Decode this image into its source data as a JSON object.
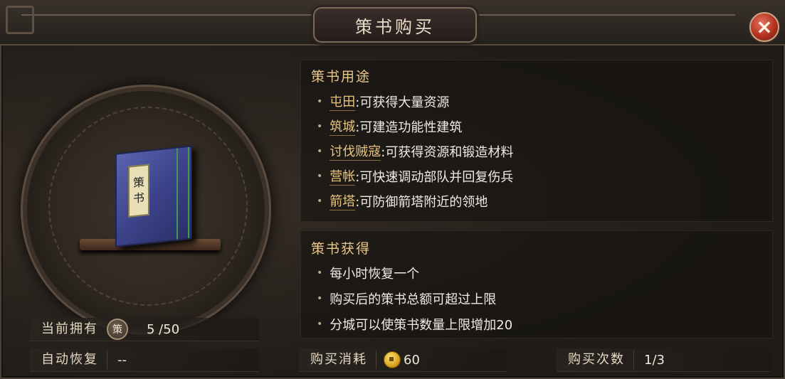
{
  "window": {
    "title": "策书购买",
    "close_glyph": "×"
  },
  "book": {
    "label_chars": [
      "策",
      "书"
    ]
  },
  "usage": {
    "heading": "策书用途",
    "items": [
      {
        "key": "屯田",
        "desc": ":可获得大量资源"
      },
      {
        "key": "筑城",
        "desc": ":可建造功能性建筑"
      },
      {
        "key": "讨伐贼寇",
        "desc": ":可获得资源和锻造材料"
      },
      {
        "key": "营帐",
        "desc": ":可快速调动部队并回复伤兵"
      },
      {
        "key": "箭塔",
        "desc": ":可防御箭塔附近的领地"
      }
    ]
  },
  "obtain": {
    "heading": "策书获得",
    "items": [
      "每小时恢复一个",
      "购买后的策书总额可超过上限",
      "分城可以使策书数量上限增加20"
    ]
  },
  "stats": {
    "owned_label": "当前拥有",
    "owned_icon_char": "策",
    "owned_value": "5 /50",
    "recover_label": "自动恢复",
    "recover_value": "--",
    "cost_label": "购买消耗",
    "cost_value": "60",
    "times_label": "购买次数",
    "times_value": "1/3"
  },
  "colors": {
    "accent_gold": "#e9c88e",
    "text": "#f0ece4",
    "close_red": "#b3321f"
  },
  "icons": [
    "close-icon",
    "book-icon",
    "ce-token-icon",
    "gold-coin-icon"
  ]
}
